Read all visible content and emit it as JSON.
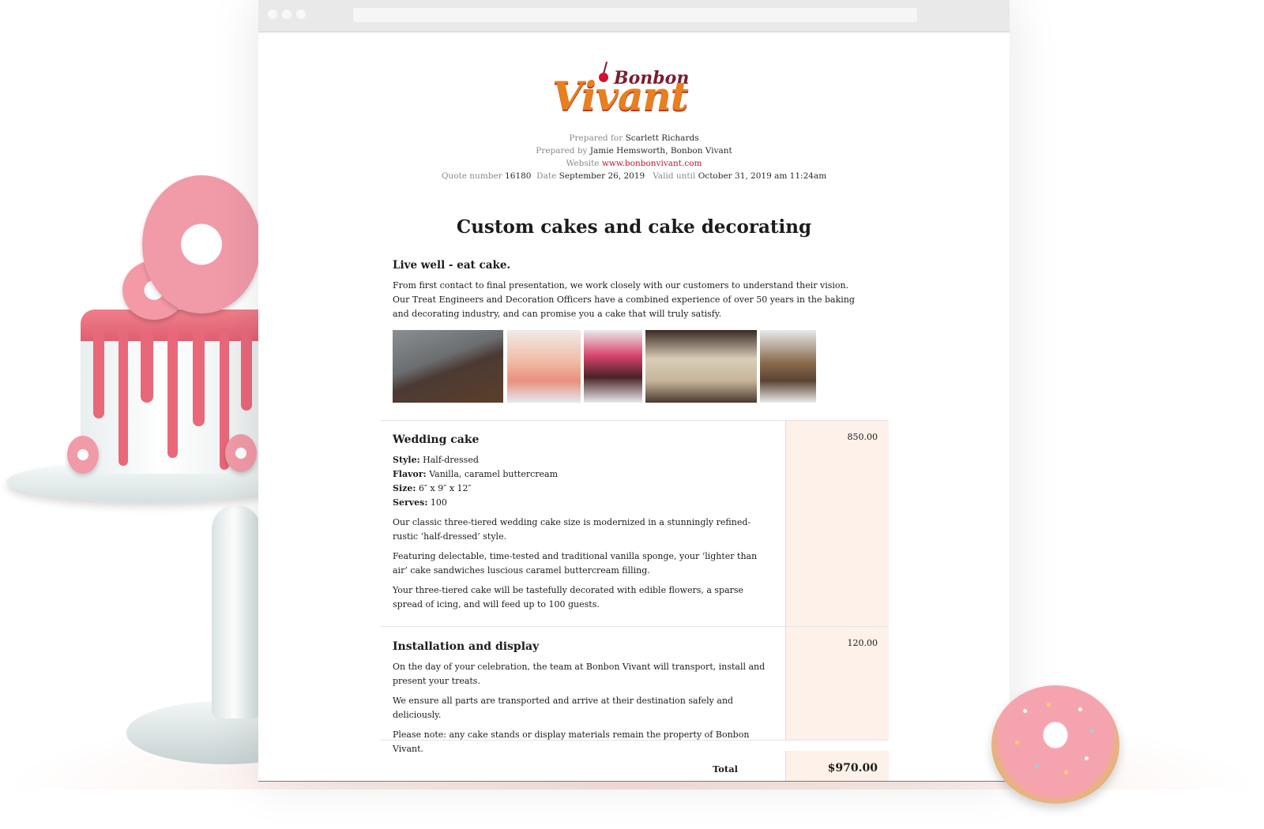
{
  "brand": {
    "logo_top": "Bonbon",
    "logo_main": "Vivant",
    "accent": "#c1172b",
    "price_bg": "#fdf1ea"
  },
  "meta": {
    "prepared_for_label": "Prepared for",
    "prepared_for": "Scarlett Richards",
    "prepared_by_label": "Prepared by",
    "prepared_by": "Jamie Hemsworth, Bonbon Vivant",
    "website_label": "Website",
    "website": "www.bonbonvivant.com",
    "quote_number_label": "Quote number",
    "quote_number": "16180",
    "date_label": "Date",
    "date": "September 26, 2019",
    "valid_until_label": "Valid until",
    "valid_until": "October 31, 2019 am 11:24am"
  },
  "document": {
    "title": "Custom cakes and cake decorating",
    "intro_heading": "Live well - eat cake.",
    "intro_text": "From first contact to final presentation, we work closely with our customers to understand their vision. Our Treat Engineers and Decoration Officers have a combined experience of over 50 years in the baking and decorating industry, and can promise you a cake that will truly satisfy."
  },
  "gallery": [
    {
      "name": "chocolate-cake-photo",
      "color": "#4b3a33"
    },
    {
      "name": "peach-drip-cake-photo",
      "color": "#e9b2a0"
    },
    {
      "name": "flower-chocolate-cake-photo",
      "color": "#6a2f3a"
    },
    {
      "name": "naked-wedding-cake-photo",
      "color": "#5c4638"
    },
    {
      "name": "layered-cake-photo",
      "color": "#b7a98f"
    }
  ],
  "items": [
    {
      "title": "Wedding cake",
      "price": "850.00",
      "specs": [
        {
          "label": "Style:",
          "value": "Half-dressed"
        },
        {
          "label": "Flavor:",
          "value": "Vanilla, caramel buttercream"
        },
        {
          "label": "Size:",
          "value": "6″ x 9″ x 12″"
        },
        {
          "label": "Serves:",
          "value": "100"
        }
      ],
      "paragraphs": [
        "Our classic three-tiered wedding cake size is modernized in a stunningly refined-rustic ‘half-dressed’ style.",
        "Featuring delectable, time-tested and traditional vanilla sponge, your ‘lighter than air’ cake sandwiches luscious caramel buttercream filling.",
        "Your three-tiered cake will be tastefully decorated with edible flowers, a sparse spread of icing, and will feed up to 100 guests."
      ]
    },
    {
      "title": "Installation and display",
      "price": "120.00",
      "paragraphs": [
        "On the day of your celebration, the team at Bonbon Vivant will transport, install and present your treats.",
        "We ensure all parts are transported and arrive at their destination safely and deliciously.",
        "Please note: any cake stands or display materials remain the property of Bonbon Vivant."
      ]
    }
  ],
  "total": {
    "label": "Total",
    "value": "$970.00"
  }
}
